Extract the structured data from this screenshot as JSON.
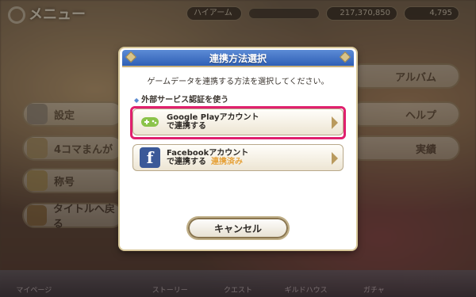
{
  "background": {
    "title": "メニュー",
    "left_buttons": [
      "設定",
      "4コマまんが",
      "称号",
      "タイトルへ戻る"
    ],
    "right_buttons": [
      "アルバム",
      "ヘルプ",
      "実績"
    ],
    "hud": {
      "rank_label": "ハイアーム",
      "mana": "217,370,850",
      "jewels": "4,795"
    },
    "nav": [
      "マイページ",
      "",
      "ストーリー",
      "クエスト",
      "ギルドハウス",
      "ガチャ",
      ""
    ]
  },
  "dialog": {
    "title": "連携方法選択",
    "message": "ゲームデータを連携する方法を選択してください。",
    "section_label": "外部サービス認証を使う",
    "google": {
      "line1": "Google Playアカウント",
      "line2": "で連携する",
      "icon": "gamepad-icon"
    },
    "facebook": {
      "line1": "Facebookアカウント",
      "line2": "で連携する",
      "status": "連携済み",
      "icon": "facebook-icon"
    },
    "cancel_label": "キャンセル"
  },
  "colors": {
    "header_blue": "#2f5fb5",
    "highlight": "#e0206e",
    "google_green": "#8bc34a",
    "facebook_blue": "#3b5998",
    "linked_orange": "#e6a23a"
  }
}
